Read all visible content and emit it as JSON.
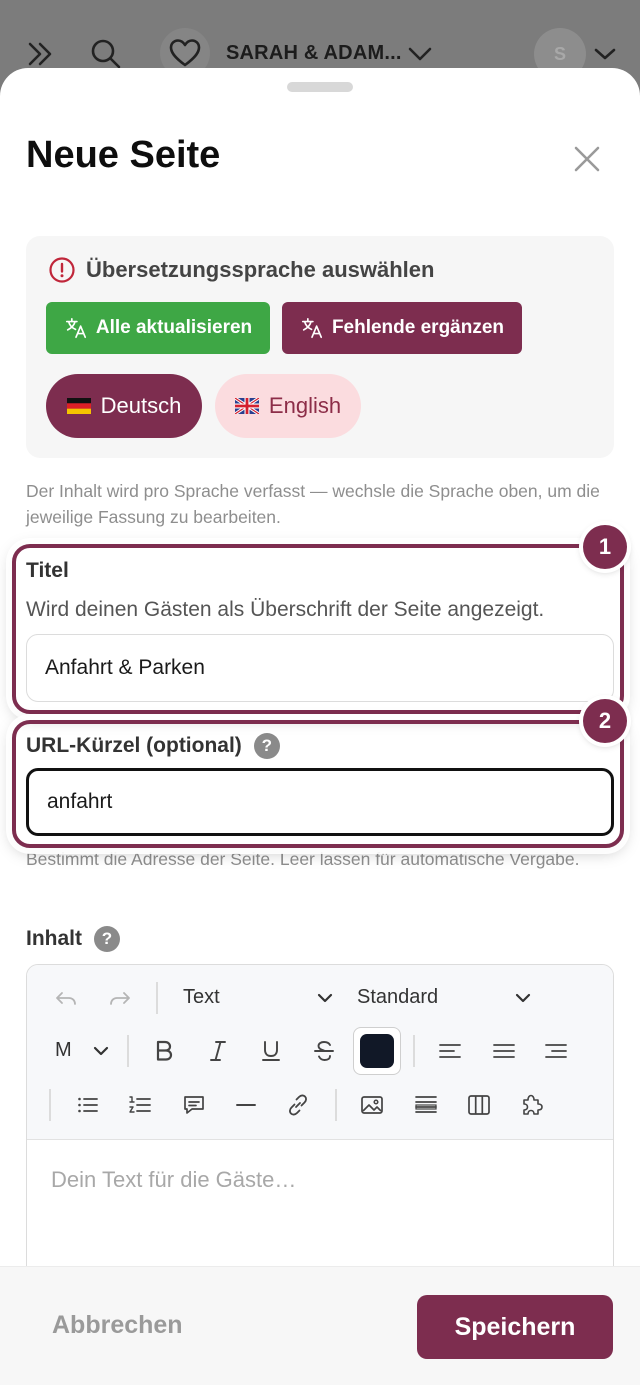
{
  "appbar": {
    "brand": "SARAH & ADAM...",
    "avatar_initial": "S",
    "icons": [
      "double-chevron-icon",
      "search-icon",
      "heart-icon",
      "chevron-down-icon"
    ]
  },
  "sheet": {
    "title": "Neue Seite"
  },
  "translation": {
    "heading": "Übersetzungssprache auswählen",
    "update_all": "Alle aktualisieren",
    "fill_missing": "Fehlende ergänzen",
    "languages": [
      {
        "label": "Deutsch",
        "active": true
      },
      {
        "label": "English",
        "active": false
      }
    ],
    "hint": "Der Inhalt wird pro Sprache verfasst — wechsle die Sprache oben, um die jeweilige Fassung zu bearbeiten."
  },
  "title_field": {
    "label": "Titel",
    "description": "Wird deinen Gästen als Überschrift der Seite angezeigt.",
    "value": "Anfahrt & Parken",
    "badge": "1"
  },
  "slug_field": {
    "label": "URL-Kürzel (optional)",
    "help": "?",
    "value": "anfahrt",
    "hint": "Bestimmt die Adresse der Seite. Leer lassen für automatische Vergabe.",
    "badge": "2"
  },
  "content_field": {
    "label": "Inhalt",
    "help": "?",
    "block_type": "Text",
    "style": "Standard",
    "font_size": "M",
    "text_color": "#111827",
    "placeholder": "Dein Text für die Gäste…"
  },
  "footer": {
    "cancel": "Abbrechen",
    "save": "Speichern"
  },
  "colors": {
    "accent": "#7d2d4f",
    "success": "#3ea745",
    "accent_light": "#fbdcdf"
  }
}
